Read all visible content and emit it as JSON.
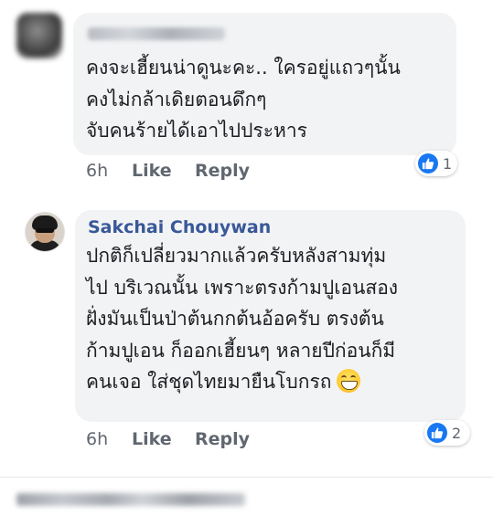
{
  "comments": [
    {
      "author": "",
      "text_lines": [
        "คงจะเฮี้ยนน่าดูนะคะ.. ใครอยู่แถวๆนั้น",
        "คงไม่กล้าเดิยตอนดึกๆ",
        "จับคนร้ายได้เอาไปประหาร"
      ],
      "time": "6h",
      "like_label": "Like",
      "reply_label": "Reply",
      "reaction_count": "1"
    },
    {
      "author": "Sakchai Chouywan",
      "text_lines": [
        "ปกติก็เปลี่ยวมากแล้วครับหลังสามทุ่ม",
        "ไป บริเวณนั้น เพราะตรงก้ามปูเอนสอง",
        "ฝั่งมันเป็นป่าต้นกกต้นอ้อครับ ตรงต้น",
        "ก้ามปูเอน ก็ออกเฮี้ยนๆ หลายปีก่อนก็มี",
        "คนเจอ ใส่ชุดไทยมายืนโบกรถ"
      ],
      "emoji": "grinning-face-emoji",
      "time": "6h",
      "like_label": "Like",
      "reply_label": "Reply",
      "reaction_count": "2"
    }
  ],
  "icons": {
    "reaction": "thumbs-up-icon"
  },
  "colors": {
    "bubble": "#f2f3f5",
    "author": "#385898",
    "text": "#1c1e21",
    "meta": "#606770",
    "like_blue": "#1877f2"
  }
}
